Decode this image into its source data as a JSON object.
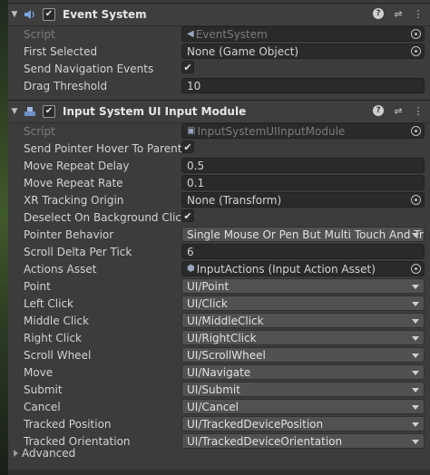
{
  "event_system": {
    "title": "Event System",
    "enabled": true,
    "fields": {
      "script_label": "Script",
      "script_value": "EventSystem",
      "first_selected_label": "First Selected",
      "first_selected_value": "None (Game Object)",
      "send_nav_label": "Send Navigation Events",
      "send_nav_checked": true,
      "drag_threshold_label": "Drag Threshold",
      "drag_threshold_value": "10"
    }
  },
  "input_module": {
    "title": "Input System UI Input Module",
    "enabled": true,
    "fields": {
      "script_label": "Script",
      "script_value": "InputSystemUIInputModule",
      "hover_label": "Send Pointer Hover To Parent",
      "hover_checked": true,
      "repeat_delay_label": "Move Repeat Delay",
      "repeat_delay_value": "0.5",
      "repeat_rate_label": "Move Repeat Rate",
      "repeat_rate_value": "0.1",
      "xr_origin_label": "XR Tracking Origin",
      "xr_origin_value": "None (Transform)",
      "deselect_label": "Deselect On Background Click",
      "deselect_checked": true,
      "pointer_behavior_label": "Pointer Behavior",
      "pointer_behavior_value": "Single Mouse Or Pen But Multi Touch And Trac",
      "scroll_delta_label": "Scroll Delta Per Tick",
      "scroll_delta_value": "6",
      "actions_asset_label": "Actions Asset",
      "actions_asset_value": "InputActions (Input Action Asset)"
    },
    "actions": [
      {
        "label": "Point",
        "value": "UI/Point"
      },
      {
        "label": "Left Click",
        "value": "UI/Click"
      },
      {
        "label": "Middle Click",
        "value": "UI/MiddleClick"
      },
      {
        "label": "Right Click",
        "value": "UI/RightClick"
      },
      {
        "label": "Scroll Wheel",
        "value": "UI/ScrollWheel"
      },
      {
        "label": "Move",
        "value": "UI/Navigate"
      },
      {
        "label": "Submit",
        "value": "UI/Submit"
      },
      {
        "label": "Cancel",
        "value": "UI/Cancel"
      },
      {
        "label": "Tracked Position",
        "value": "UI/TrackedDevicePosition"
      },
      {
        "label": "Tracked Orientation",
        "value": "UI/TrackedDeviceOrientation"
      }
    ],
    "advanced_label": "Advanced"
  },
  "icons": [
    "foldout-arrow",
    "event-system-icon",
    "input-module-icon",
    "help-icon",
    "presets-icon",
    "kebab-menu-icon",
    "object-picker-icon",
    "dropdown-caret-icon"
  ]
}
